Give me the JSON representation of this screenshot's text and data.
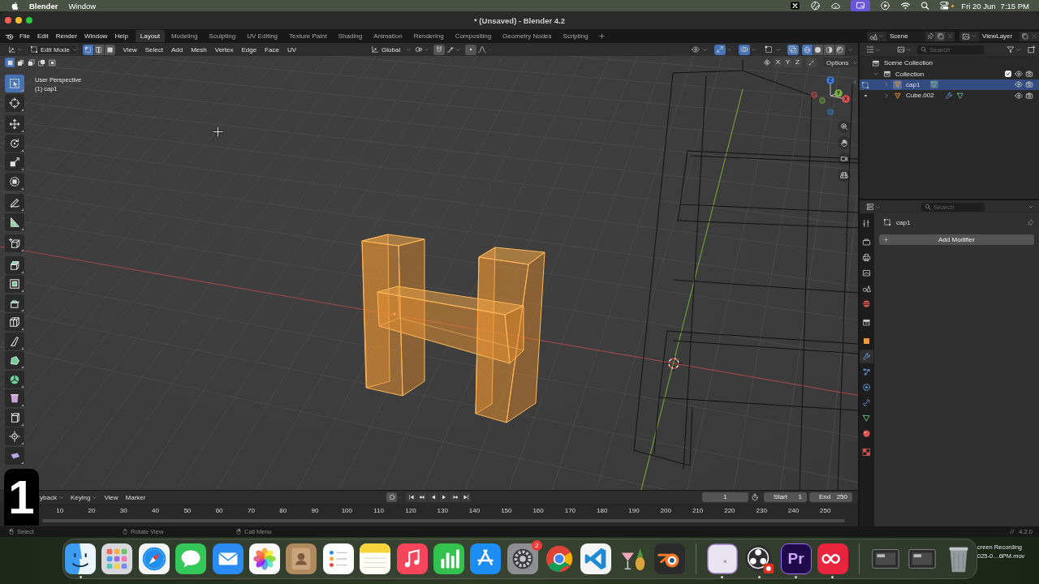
{
  "menubar": {
    "app": "Blender",
    "menus": [
      "Window"
    ],
    "date": "Fri 20 Jun",
    "time": "7:15 PM"
  },
  "window": {
    "title": "* (Unsaved) - Blender 4.2"
  },
  "topbar": {
    "menus": [
      "File",
      "Edit",
      "Render",
      "Window",
      "Help"
    ],
    "workspaces": [
      {
        "label": "Layout",
        "selected": true
      },
      {
        "label": "Modeling",
        "selected": false
      },
      {
        "label": "Sculpting",
        "selected": false
      },
      {
        "label": "UV Editing",
        "selected": false
      },
      {
        "label": "Texture Paint",
        "selected": false
      },
      {
        "label": "Shading",
        "selected": false
      },
      {
        "label": "Animation",
        "selected": false
      },
      {
        "label": "Rendering",
        "selected": false
      },
      {
        "label": "Compositing",
        "selected": false
      },
      {
        "label": "Geometry Nodes",
        "selected": false
      },
      {
        "label": "Scripting",
        "selected": false
      }
    ],
    "scene": "Scene",
    "view_layer": "ViewLayer"
  },
  "viewport_header": {
    "mode": "Edit Mode",
    "select_modes": [
      {
        "kind": "vertex",
        "selected": true
      },
      {
        "kind": "edge",
        "selected": false
      },
      {
        "kind": "face",
        "selected": false
      }
    ],
    "menus": [
      "View",
      "Select",
      "Add",
      "Mesh",
      "Vertex",
      "Edge",
      "Face",
      "UV"
    ],
    "orientation": "Global",
    "toggles": [
      {
        "kind": "selectability",
        "on": false
      },
      {
        "kind": "gizmos",
        "on": true
      },
      {
        "kind": "overlays",
        "on": true
      },
      {
        "kind": "mesh-overlays",
        "on": false
      },
      {
        "kind": "xray",
        "on": true
      }
    ],
    "shading": [
      {
        "kind": "wireframe",
        "selected": true
      },
      {
        "kind": "solid",
        "selected": false
      },
      {
        "kind": "material",
        "selected": false
      },
      {
        "kind": "rendered",
        "selected": false
      }
    ]
  },
  "viewport": {
    "box_modes": [
      {
        "kind": "set",
        "selected": true
      },
      {
        "kind": "extend",
        "selected": false
      },
      {
        "kind": "subtract",
        "selected": false
      },
      {
        "kind": "invert",
        "selected": false
      },
      {
        "kind": "intersect",
        "selected": false
      }
    ],
    "mirror_axes": [
      "X",
      "Y",
      "Z"
    ],
    "options": "Options",
    "info": [
      "User Perspective",
      "(1) cap1"
    ],
    "gizmo_axes": [
      "X",
      "Y",
      "Z"
    ],
    "tool_groups": [
      [
        {
          "kind": "select-box",
          "selected": true
        },
        {
          "kind": "cursor",
          "selected": false
        }
      ],
      [
        {
          "kind": "move",
          "selected": false
        },
        {
          "kind": "rotate",
          "selected": false
        },
        {
          "kind": "scale",
          "selected": false
        },
        {
          "kind": "transform",
          "selected": false
        }
      ],
      [
        {
          "kind": "annotate",
          "selected": false
        },
        {
          "kind": "measure",
          "selected": false
        }
      ],
      [
        {
          "kind": "add-cube",
          "selected": false
        }
      ],
      [
        {
          "kind": "extrude",
          "selected": false
        },
        {
          "kind": "inset",
          "selected": false
        },
        {
          "kind": "bevel",
          "selected": false
        },
        {
          "kind": "loop-cut",
          "selected": false
        },
        {
          "kind": "knife",
          "selected": false
        },
        {
          "kind": "poly-build",
          "selected": false
        },
        {
          "kind": "spin",
          "selected": false
        },
        {
          "kind": "smooth",
          "selected": false
        },
        {
          "kind": "edge-slide",
          "selected": false
        },
        {
          "kind": "shrink-fatten",
          "selected": false
        },
        {
          "kind": "shear",
          "selected": false
        }
      ]
    ]
  },
  "outliner": {
    "search": {
      "placeholder": "Search"
    },
    "tree": [
      {
        "kind": "scene-collection",
        "label": "Scene Collection",
        "selected": false,
        "children": [
          {
            "kind": "collection",
            "label": "Collection",
            "selected": false,
            "expanded": true,
            "checked": true,
            "visible": true,
            "renderable": true,
            "children": [
              {
                "kind": "mesh-object",
                "label": "cap1",
                "selected": true,
                "expanded": false,
                "in_edit_mode": true,
                "has_modifier": false,
                "visible": true,
                "renderable": true
              },
              {
                "kind": "mesh-object",
                "label": "Cube.002",
                "selected": false,
                "expanded": false,
                "in_edit_mode": false,
                "has_modifier": true,
                "visible": true,
                "renderable": true
              }
            ]
          }
        ]
      }
    ]
  },
  "properties": {
    "search": {
      "placeholder": "Search"
    },
    "tab_groups": [
      [
        {
          "kind": "tool",
          "selected": false
        }
      ],
      [
        {
          "kind": "render",
          "selected": false
        },
        {
          "kind": "output",
          "selected": false
        },
        {
          "kind": "view-layer",
          "selected": false
        },
        {
          "kind": "scene",
          "selected": false
        },
        {
          "kind": "world",
          "selected": false
        }
      ],
      [
        {
          "kind": "collection",
          "selected": false
        }
      ],
      [
        {
          "kind": "object",
          "selected": false
        },
        {
          "kind": "modifiers",
          "selected": true
        },
        {
          "kind": "particles",
          "selected": false
        },
        {
          "kind": "physics",
          "selected": false
        },
        {
          "kind": "constraints",
          "selected": false
        },
        {
          "kind": "data",
          "selected": false
        },
        {
          "kind": "material",
          "selected": false
        }
      ],
      [
        {
          "kind": "texture",
          "selected": false
        }
      ]
    ],
    "object": "cap1",
    "add_modifier": "Add Modifier"
  },
  "timeline": {
    "menus": [
      "yback",
      "Keying",
      "View",
      "Marker"
    ],
    "current_frame": "1",
    "start_label": "Start",
    "start": "1",
    "end_label": "End",
    "end": "250",
    "ruler": [
      "10",
      "20",
      "30",
      "40",
      "50",
      "60",
      "70",
      "80",
      "90",
      "100",
      "110",
      "120",
      "130",
      "140",
      "150",
      "160",
      "170",
      "180",
      "190",
      "200",
      "210",
      "220",
      "230",
      "240",
      "250"
    ]
  },
  "status_bar": {
    "hints": [
      "Select",
      "Rotate View",
      "Call Menu"
    ],
    "version": "4.2.0"
  },
  "key_overlay": {
    "key": "1"
  },
  "desktop": {
    "file_label": [
      "creen Recording",
      "025-0…6PM.mov"
    ]
  },
  "dock": {
    "items": [
      {
        "kind": "finder",
        "running": true
      },
      {
        "kind": "launchpad",
        "running": false
      },
      {
        "kind": "safari",
        "running": false
      },
      {
        "kind": "messages",
        "running": false
      },
      {
        "kind": "mail",
        "running": false
      },
      {
        "kind": "photos",
        "running": false
      },
      {
        "kind": "contacts",
        "running": false
      },
      {
        "kind": "reminders",
        "running": false
      },
      {
        "kind": "notes",
        "running": false
      },
      {
        "kind": "music",
        "running": false
      },
      {
        "kind": "numbers",
        "running": false
      },
      {
        "kind": "app-store",
        "running": false
      },
      {
        "kind": "settings",
        "running": false,
        "badge": "2"
      },
      {
        "kind": "chrome",
        "running": false
      },
      {
        "kind": "vscode",
        "running": false
      },
      {
        "kind": "cocktail",
        "running": false
      },
      {
        "kind": "blender",
        "running": false
      },
      {
        "kind": "separator"
      },
      {
        "kind": "blank-app",
        "running": true
      },
      {
        "kind": "obs",
        "running": true
      },
      {
        "kind": "premiere",
        "running": true,
        "label": "Pr"
      },
      {
        "kind": "creative-cloud",
        "running": true
      },
      {
        "kind": "separator"
      },
      {
        "kind": "stack",
        "running": false
      },
      {
        "kind": "stack",
        "running": false
      },
      {
        "kind": "trash",
        "running": false
      }
    ]
  }
}
